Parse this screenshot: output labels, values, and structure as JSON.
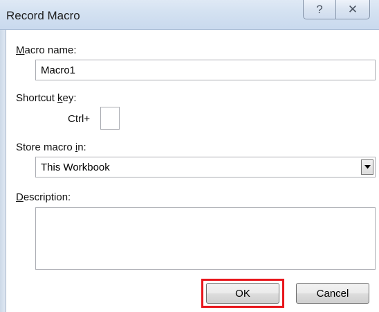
{
  "window": {
    "title": "Record Macro",
    "help_glyph": "?",
    "close_glyph": "✕"
  },
  "form": {
    "macro_name": {
      "label_accel": "M",
      "label_rest": "acro name:",
      "value": "Macro1"
    },
    "shortcut": {
      "label_pre": "Shortcut ",
      "label_accel": "k",
      "label_post": "ey:",
      "ctrl_prefix": "Ctrl+",
      "value": ""
    },
    "store_in": {
      "label_pre": "Store macro ",
      "label_accel": "i",
      "label_post": "n:",
      "selected": "This Workbook"
    },
    "description": {
      "label_accel": "D",
      "label_rest": "escription:",
      "value": ""
    }
  },
  "buttons": {
    "ok": "OK",
    "cancel": "Cancel"
  },
  "colors": {
    "highlight": "#e8151b"
  },
  "icons": [
    "help-icon",
    "close-icon",
    "dropdown-arrow-icon"
  ]
}
